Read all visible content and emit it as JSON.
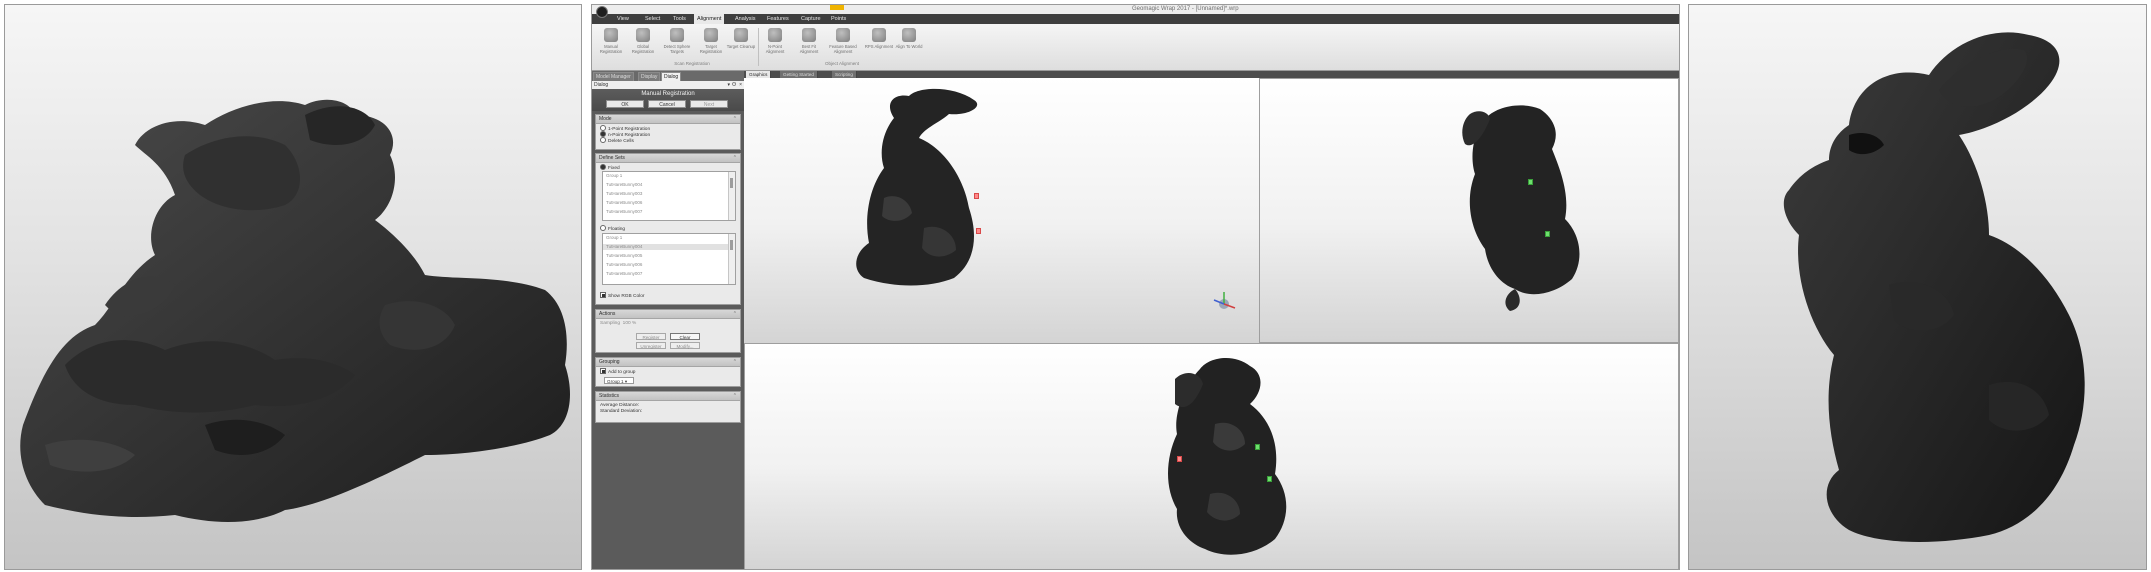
{
  "window": {
    "title": "Geomagic Wrap 2017 - [Unnamed]*.wrp"
  },
  "menu": {
    "items": [
      "View",
      "Select",
      "Tools",
      "Alignment",
      "Analysis",
      "Features",
      "Capture",
      "Points"
    ],
    "active": "Alignment"
  },
  "ribbon": {
    "buttons": [
      {
        "label": "Manual Registration",
        "icon": "manual-registration-icon"
      },
      {
        "label": "Global Registration",
        "icon": "global-registration-icon"
      },
      {
        "label": "Detect Sphere Targets",
        "icon": "detect-sphere-icon"
      },
      {
        "label": "Target Registration",
        "icon": "target-registration-icon"
      },
      {
        "label": "Target Cleanup",
        "icon": "target-cleanup-icon"
      },
      {
        "label": "N-Point Alignment",
        "icon": "n-point-icon"
      },
      {
        "label": "Best Fit Alignment",
        "icon": "best-fit-icon"
      },
      {
        "label": "Feature Based Alignment",
        "icon": "feature-alignment-icon"
      },
      {
        "label": "RPS Alignment",
        "icon": "rps-alignment-icon"
      },
      {
        "label": "Align To World",
        "icon": "align-world-icon"
      }
    ],
    "groups": [
      "Scan Registration",
      "Object Alignment"
    ]
  },
  "sidebar": {
    "tabs": [
      "Model Manager",
      "Display",
      "Dialog"
    ],
    "active_tab": "Dialog",
    "dialog_title": "Dialog",
    "dialog_controls": [
      "▾",
      "ʘ",
      "×"
    ]
  },
  "manual_registration": {
    "title": "Manual Registration",
    "ok": "OK",
    "cancel": "Cancel",
    "next": "Next"
  },
  "mode": {
    "title": "Mode",
    "options": [
      "1-Point Registration",
      "n-Point Registration",
      "Delete Cells"
    ],
    "selected": 1
  },
  "define_sets": {
    "title": "Define Sets",
    "fixed_label": "Fixed",
    "fixed_items": [
      "Group 1",
      "TutHareBunny004",
      "TutHareBunny003",
      "TutHareBunny006",
      "TutHareBunny007"
    ],
    "floating_label": "Floating",
    "floating_items": [
      "Group 1",
      "TutHareBunny004",
      "TutHareBunny005",
      "TutHareBunny006",
      "TutHareBunny007"
    ],
    "floating_selected": 1,
    "show_rgb": "Show RGB Color"
  },
  "actions": {
    "title": "Actions",
    "sampling_label": "Sampling",
    "sampling_value": "100 %",
    "register": "Register",
    "clear": "Clear",
    "unregister": "Unregister",
    "modify": "Modify..."
  },
  "grouping": {
    "title": "Grouping",
    "add_to_group": "Add to group",
    "group_value": "Group 1"
  },
  "statistics": {
    "title": "Statistics",
    "rows": [
      "Average Distance:",
      "Standard Deviation:"
    ]
  },
  "view_tabs": [
    "Graphics",
    "Getting Started",
    "Scripting"
  ],
  "view_tab_active": "Graphics",
  "colors": {
    "menubar": "#3e3e3e",
    "sidebar": "#5b5b5b",
    "marker_green": "#6ee06e",
    "marker_red": "#ff8a8a"
  }
}
